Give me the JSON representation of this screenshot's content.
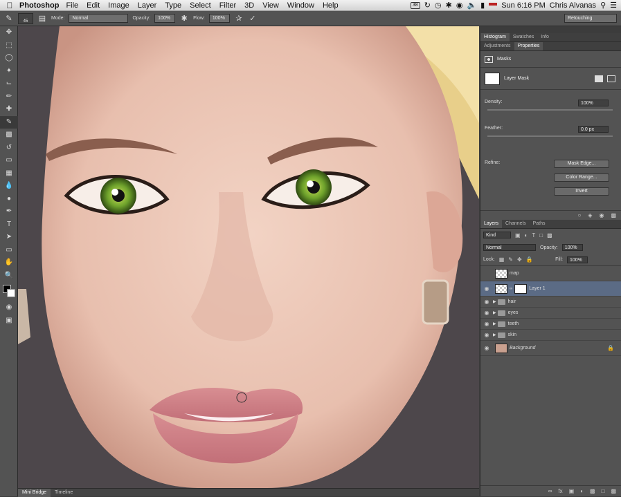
{
  "menubar": {
    "app_name": "Photoshop",
    "menus": [
      "File",
      "Edit",
      "Image",
      "Layer",
      "Type",
      "Select",
      "Filter",
      "3D",
      "View",
      "Window",
      "Help"
    ],
    "time": "Sun 6:16 PM",
    "user": "Chris Alvanas",
    "adobe_badge": "38"
  },
  "options": {
    "brush_size": "45",
    "mode_label": "Mode:",
    "mode_value": "Normal",
    "opacity_label": "Opacity:",
    "opacity_value": "100%",
    "flow_label": "Flow:",
    "flow_value": "100%",
    "workspace": "Retouching"
  },
  "bottom_tabs": [
    "Mini Bridge",
    "Timeline"
  ],
  "properties": {
    "tabs_top": [
      "Histogram",
      "Swatches",
      "Info"
    ],
    "tabs": [
      "Adjustments",
      "Properties"
    ],
    "header": "Masks",
    "mask_name": "Layer Mask",
    "density_label": "Density:",
    "density_value": "100%",
    "feather_label": "Feather:",
    "feather_value": "0.0 px",
    "refine_label": "Refine:",
    "btn_mask_edge": "Mask Edge...",
    "btn_color_range": "Color Range...",
    "btn_invert": "Invert"
  },
  "layers": {
    "tabs": [
      "Layers",
      "Channels",
      "Paths"
    ],
    "filter_kind": "Kind",
    "blend_mode": "Normal",
    "opacity_label": "Opacity:",
    "opacity_value": "100%",
    "lock_label": "Lock:",
    "fill_label": "Fill:",
    "fill_value": "100%",
    "items": [
      {
        "name": "map"
      },
      {
        "name": "Layer 1"
      },
      {
        "name": "hair"
      },
      {
        "name": "eyes"
      },
      {
        "name": "teeth"
      },
      {
        "name": "skin"
      },
      {
        "name": "Background"
      }
    ]
  },
  "colors": {
    "panel": "#535353",
    "selected_layer": "#5b6b85"
  }
}
